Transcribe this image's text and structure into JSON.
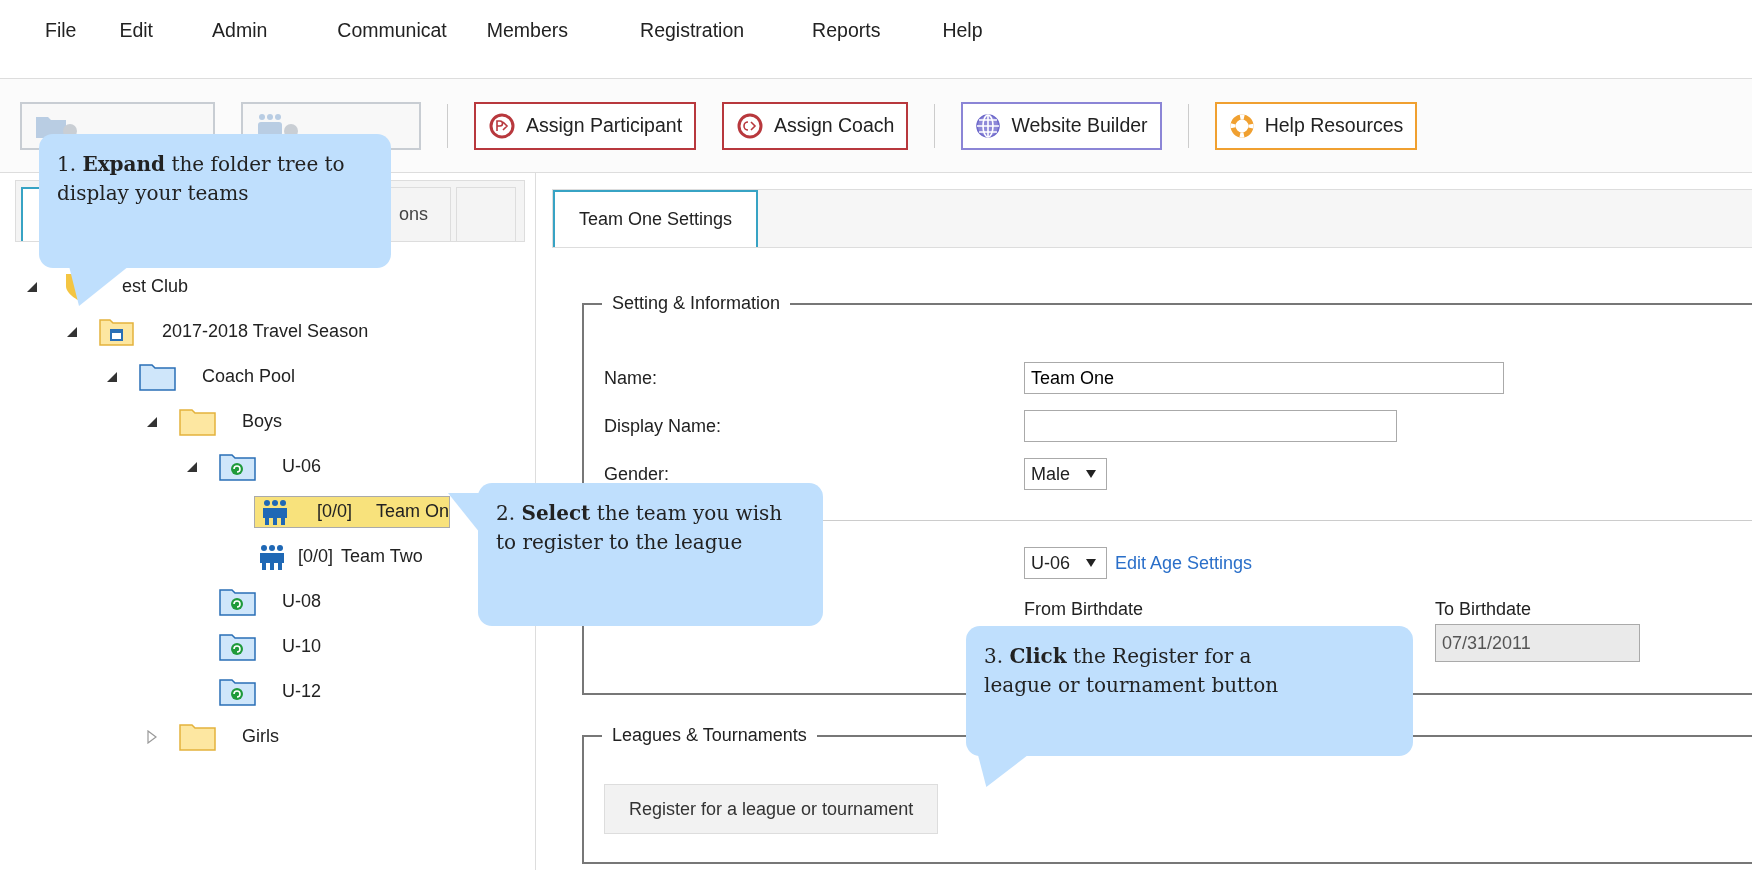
{
  "menu": [
    "File",
    "Edit",
    "Admin",
    "Communicat",
    "Members",
    "Registration",
    "Reports",
    "Help"
  ],
  "toolbar": [
    [
      {
        "kind": "folder-add",
        "disabled": true,
        "color": "#c8cdd3"
      },
      {
        "kind": "team-add",
        "disabled": true,
        "color": "#c8cdd3"
      }
    ],
    [
      {
        "kind": "participant",
        "label": "Assign Participant",
        "disabled": false,
        "color": "#b8383d"
      },
      {
        "kind": "coach",
        "label": "Assign Coach",
        "disabled": false,
        "color": "#b8383d"
      }
    ],
    [
      {
        "kind": "globe",
        "label": "Website Builder",
        "disabled": false,
        "color": "#8b85d6"
      }
    ],
    [
      {
        "kind": "lifebuoy",
        "label": "Help Resources",
        "disabled": false,
        "color": "#f0a030"
      }
    ]
  ],
  "left_tabs": [
    {
      "selected": true
    },
    {
      "label": "ons",
      "selected": false
    },
    {
      "selected": false
    }
  ],
  "tree": [
    {
      "kind": "club",
      "label": "est Club",
      "expanded": true,
      "selected": false,
      "children": [
        {
          "kind": "season",
          "label": "2017-2018 Travel Season",
          "expanded": true,
          "selected": false,
          "children": [
            {
              "kind": "pool",
              "label": "Coach Pool",
              "expanded": true,
              "selected": false,
              "children": [
                {
                  "kind": "folder",
                  "label": "Boys",
                  "expanded": true,
                  "selected": false,
                  "children": [
                    {
                      "kind": "age",
                      "label": "U-06",
                      "expanded": true,
                      "selected": false,
                      "children": [
                        {
                          "kind": "team",
                          "count": "[0/0]",
                          "label": "Team On",
                          "selected": true
                        },
                        {
                          "kind": "team",
                          "count": "[0/0]",
                          "label": "Team Two",
                          "selected": false
                        }
                      ]
                    },
                    {
                      "kind": "age",
                      "label": "U-08",
                      "selected": false
                    },
                    {
                      "kind": "age",
                      "label": "U-10",
                      "selected": false
                    },
                    {
                      "kind": "age",
                      "label": "U-12",
                      "selected": false
                    }
                  ]
                },
                {
                  "kind": "folder",
                  "label": "Girls",
                  "expanded": false,
                  "selected": false
                }
              ]
            }
          ]
        }
      ]
    }
  ],
  "right_tab": {
    "label": "Team One Settings",
    "selected": true
  },
  "settings": {
    "legend": "Setting & Information",
    "fields": [
      {
        "label": "Name:",
        "kind": "text",
        "value": "Team One"
      },
      {
        "label": "Display Name:",
        "kind": "text"
      },
      {
        "label": "Gender:",
        "kind": "select",
        "value": "Male"
      }
    ],
    "age_select": "U-06",
    "age_link": "Edit Age Settings",
    "from_label": "From Birthdate",
    "to_label": "To Birthdate",
    "to_value": "07/31/2011",
    "to_disabled": true
  },
  "leagues": {
    "legend": "Leagues & Tournaments",
    "button": "Register for a league or tournament"
  },
  "callouts": [
    "1. **Expand** the folder tree to display your teams",
    "2. **Select** the team you wish to register to the league",
    "3. **Click** the Register for a league or tournament button"
  ]
}
